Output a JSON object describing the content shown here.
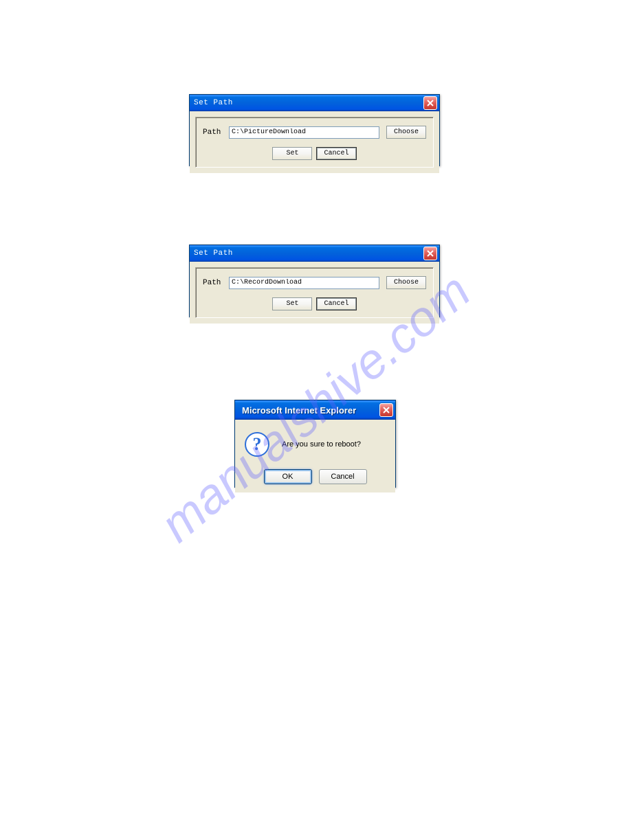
{
  "dialog1": {
    "title": "Set Path",
    "path_label": "Path",
    "path_value": "C:\\PictureDownload",
    "choose_label": "Choose",
    "set_label": "Set",
    "cancel_label": "Cancel"
  },
  "dialog2": {
    "title": "Set Path",
    "path_label": "Path",
    "path_value": "C:\\RecordDownload",
    "choose_label": "Choose",
    "set_label": "Set",
    "cancel_label": "Cancel"
  },
  "dialog3": {
    "title": "Microsoft Internet Explorer",
    "message": "Are you sure to reboot?",
    "ok_label": "OK",
    "cancel_label": "Cancel"
  },
  "watermark": "manualshive.com"
}
